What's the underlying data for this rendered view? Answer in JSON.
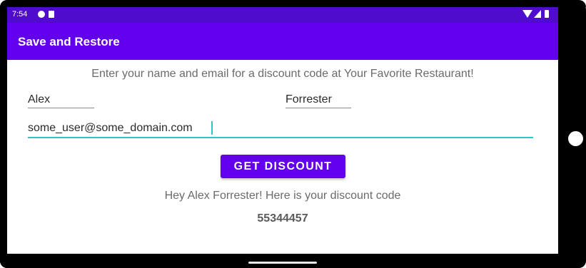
{
  "status_bar": {
    "time": "7:54"
  },
  "app_bar": {
    "title": "Save and Restore"
  },
  "form": {
    "instructions": "Enter your name and email for a discount code at Your Favorite Restaurant!",
    "first_name": "Alex",
    "last_name": "Forrester",
    "email": "some_user@some_domain.com",
    "button_label": "GET DISCOUNT"
  },
  "result": {
    "message": "Hey Alex Forrester! Here is your discount code",
    "code": "55344457"
  },
  "colors": {
    "primary": "#6200ee",
    "primary_dark": "#4f0ccc",
    "accent": "#2ec8c0"
  },
  "icons": [
    "notification-icon",
    "sim-card-icon",
    "wifi-icon",
    "signal-icon",
    "battery-icon"
  ]
}
